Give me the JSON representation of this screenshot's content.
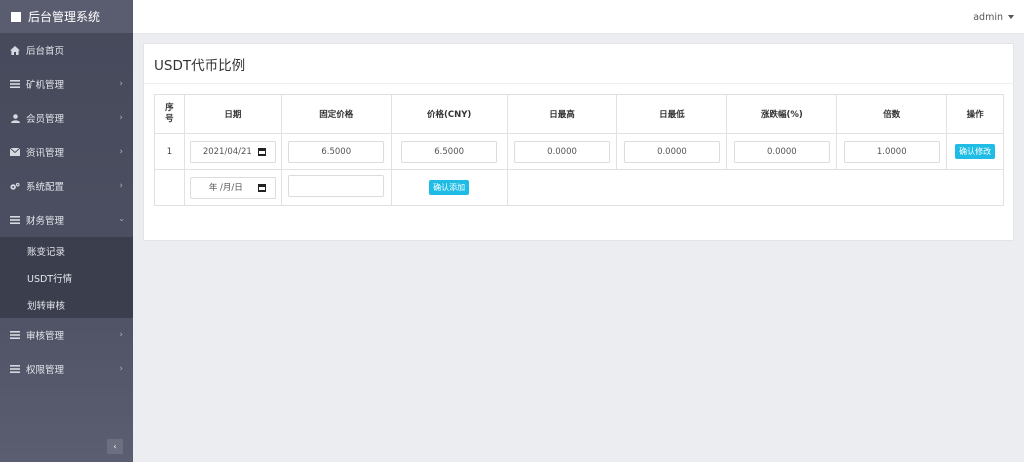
{
  "sidebar": {
    "brand": "后台管理系统",
    "items": [
      {
        "label": "后台首页",
        "icon": "home-icon",
        "has_children": false
      },
      {
        "label": "矿机管理",
        "icon": "list-icon",
        "has_children": true
      },
      {
        "label": "会员管理",
        "icon": "user-icon",
        "has_children": true
      },
      {
        "label": "资讯管理",
        "icon": "envelope-icon",
        "has_children": true
      },
      {
        "label": "系统配置",
        "icon": "gears-icon",
        "has_children": true
      },
      {
        "label": "财务管理",
        "icon": "list-icon",
        "has_children": true,
        "expanded": true
      }
    ],
    "finance_sub": [
      "账变记录",
      "USDT行情",
      "划转审核"
    ],
    "items_after": [
      {
        "label": "审核管理",
        "icon": "list-icon",
        "has_children": true
      },
      {
        "label": "权限管理",
        "icon": "list-icon",
        "has_children": true
      }
    ],
    "collapse_glyph": "‹"
  },
  "topbar": {
    "user": "admin"
  },
  "panel": {
    "title": "USDT代币比例"
  },
  "table": {
    "headers": [
      "序号",
      "日期",
      "固定价格",
      "价格(CNY)",
      "日最高",
      "日最低",
      "涨跌幅(%)",
      "倍数",
      "操作"
    ],
    "row": {
      "index": "1",
      "date": "2021/04/21",
      "fixed_price": "6.5000",
      "price_cny": "6.5000",
      "day_high": "0.0000",
      "day_low": "0.0000",
      "change_pct": "0.0000",
      "multiplier": "1.0000",
      "action_label": "确认修改"
    },
    "new_row": {
      "date_placeholder": "年 /月/日",
      "add_label": "确认添加"
    }
  },
  "colors": {
    "accent": "#1fbde6",
    "sidebar_bg": "#4b4f61"
  }
}
